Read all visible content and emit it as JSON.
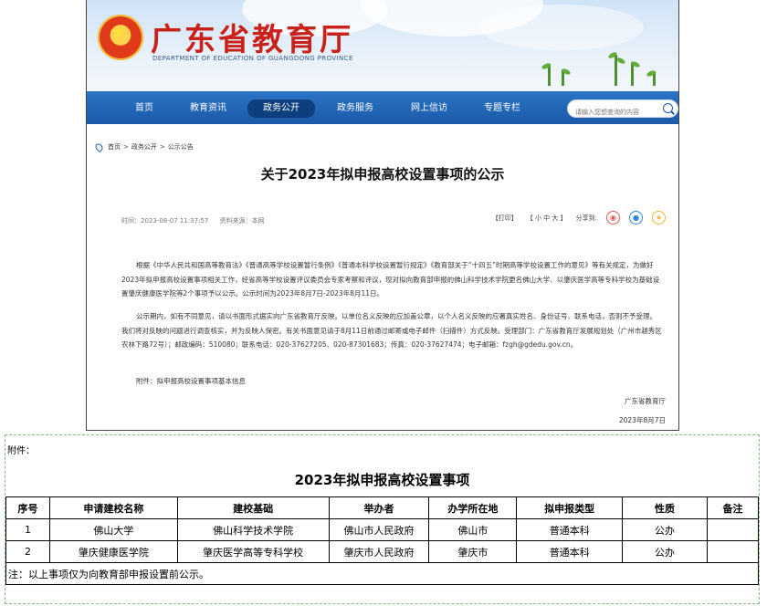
{
  "site": {
    "title": "广东省教育厅",
    "subtitle": "DEPARTMENT OF EDUCATION OF GUANGDONG PROVINCE"
  },
  "nav": {
    "items": [
      "首页",
      "教育资讯",
      "政务公开",
      "政务服务",
      "网上信访",
      "专题专栏"
    ],
    "active_index": 2,
    "search_placeholder": "请输入您想查询的内容"
  },
  "breadcrumb": [
    "首页",
    "政务公开",
    "公示公告"
  ],
  "article": {
    "title": "关于2023年拟申报高校设置事项的公示",
    "time_label": "时间：2023-08-07 11:37:57",
    "source_label": "资料来源：本网",
    "print_label": "【打印】",
    "font_label": "【 小  中  大 】",
    "share_label": "分享到:",
    "para1": "根据《中华人民共和国高等教育法》《普通高等学校设置暂行条例》《普通本科学校设置暂行规定》《教育部关于“十四五”时期高等学校设置工作的意见》等有关规定，为做好2023年拟申报高校设置事项相关工作，经省高等学校设置评议委员会专家考察和评议，现对拟向教育部申报的佛山科学技术学院更名佛山大学、以肇庆医学高等专科学校为基础设置肇庆健康医学院等2个事项予以公示。公示时间为2023年8月7日-2023年8月11日。",
    "para2": "公示期内，如有不同意见，请以书面形式据实向广东省教育厅反映。以单位名义反映的应加盖公章，以个人名义反映的应署真实姓名、身份证号、联系电话，否则不予受理。我们将对反映的问题进行调查核实，并为反映人保密。有关书面意见请于8月11日前通过邮寄或电子邮件（扫描件）方式反映。受理部门：广东省教育厅发展规划处（广州市越秀区农林下路72号）；邮政编码：510080；联系电话：020-37627205、020-87301683；传真：020-37627474；电子邮箱：fzgh@gdedu.gov.cn。",
    "attachment_note": "附件：拟申报高校设置事项基本信息",
    "signer": "广东省教育厅",
    "date": "2023年8月7日"
  },
  "attachment": {
    "label": "附件：",
    "title": "2023年拟申报高校设置事项",
    "headers": [
      "序号",
      "申请建校名称",
      "建校基础",
      "举办者",
      "办学所在地",
      "拟申报类型",
      "性质",
      "备注"
    ],
    "rows": [
      [
        "1",
        "佛山大学",
        "佛山科学技术学院",
        "佛山市人民政府",
        "佛山市",
        "普通本科",
        "公办",
        ""
      ],
      [
        "2",
        "肇庆健康医学院",
        "肇庆医学高等专科学校",
        "肇庆市人民政府",
        "肇庆市",
        "普通本科",
        "公办",
        ""
      ]
    ],
    "note": "注：以上事项仅为向教育部申报设置前公示。"
  },
  "colors": {
    "nav_blue": "#1b5aa8",
    "title_red": "#c8221a",
    "dashed_green": "#7fbf7f"
  },
  "icons": [
    "emblem-icon",
    "search-icon",
    "location-icon",
    "weibo-icon",
    "qq-icon",
    "qzone-icon"
  ]
}
